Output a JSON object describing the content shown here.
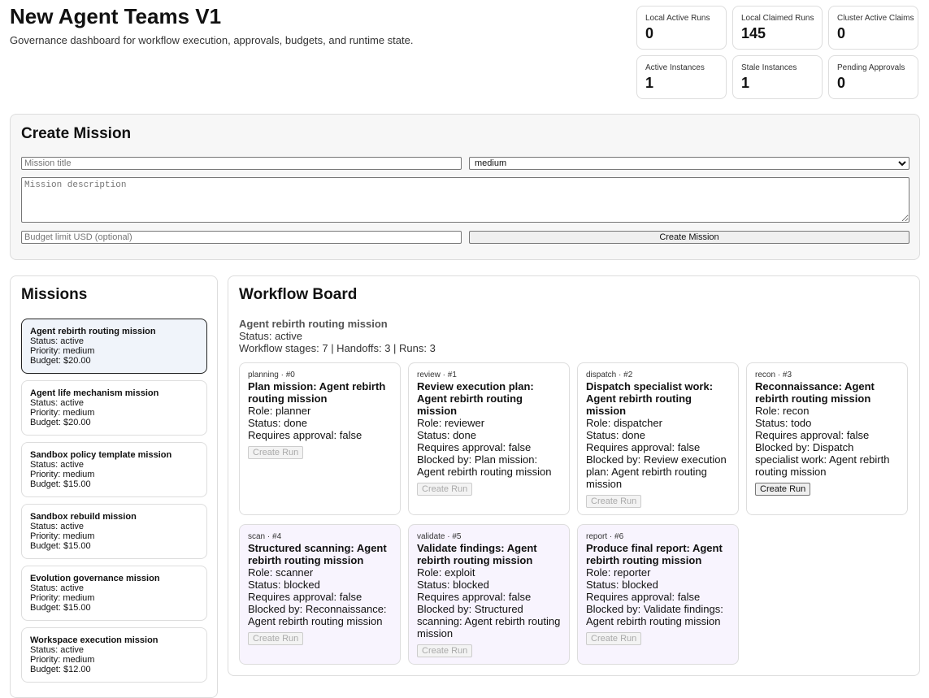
{
  "app": {
    "title": "New Agent Teams V1",
    "subtitle": "Governance dashboard for workflow execution, approvals, budgets, and runtime state."
  },
  "stats": [
    {
      "label": "Local Active Runs",
      "value": "0"
    },
    {
      "label": "Local Claimed Runs",
      "value": "145"
    },
    {
      "label": "Cluster Active Claims",
      "value": "0"
    },
    {
      "label": "Active Instances",
      "value": "1"
    },
    {
      "label": "Stale Instances",
      "value": "1"
    },
    {
      "label": "Pending Approvals",
      "value": "0"
    }
  ],
  "create_mission": {
    "heading": "Create Mission",
    "title_placeholder": "Mission title",
    "priority_value": "medium",
    "description_placeholder": "Mission description",
    "budget_placeholder": "Budget limit USD (optional)",
    "submit_label": "Create Mission"
  },
  "missions": {
    "heading": "Missions",
    "items": [
      {
        "name": "Agent rebirth routing mission",
        "status": "Status: active",
        "priority": "Priority: medium",
        "budget": "Budget: $20.00"
      },
      {
        "name": "Agent life mechanism mission",
        "status": "Status: active",
        "priority": "Priority: medium",
        "budget": "Budget: $20.00"
      },
      {
        "name": "Sandbox policy template mission",
        "status": "Status: active",
        "priority": "Priority: medium",
        "budget": "Budget: $15.00"
      },
      {
        "name": "Sandbox rebuild mission",
        "status": "Status: active",
        "priority": "Priority: medium",
        "budget": "Budget: $15.00"
      },
      {
        "name": "Evolution governance mission",
        "status": "Status: active",
        "priority": "Priority: medium",
        "budget": "Budget: $15.00"
      },
      {
        "name": "Workspace execution mission",
        "status": "Status: active",
        "priority": "Priority: medium",
        "budget": "Budget: $12.00"
      }
    ]
  },
  "board": {
    "heading": "Workflow Board",
    "mission_name": "Agent rebirth routing mission",
    "status": "Status: active",
    "counts": "Workflow stages: 7 | Handoffs: 3 | Runs: 3",
    "run_button_label": "Create Run",
    "stages": [
      {
        "meta": "planning · #0",
        "title": "Plan mission: Agent rebirth routing mission",
        "role": "Role: planner",
        "status": "Status: done",
        "approval": "Requires approval: false",
        "blocked_by": ""
      },
      {
        "meta": "review · #1",
        "title": "Review execution plan: Agent rebirth routing mission",
        "role": "Role: reviewer",
        "status": "Status: done",
        "approval": "Requires approval: false",
        "blocked_by": "Blocked by: Plan mission: Agent rebirth routing mission"
      },
      {
        "meta": "dispatch · #2",
        "title": "Dispatch specialist work: Agent rebirth routing mission",
        "role": "Role: dispatcher",
        "status": "Status: done",
        "approval": "Requires approval: false",
        "blocked_by": "Blocked by: Review execution plan: Agent rebirth routing mission"
      },
      {
        "meta": "recon · #3",
        "title": "Reconnaissance: Agent rebirth routing mission",
        "role": "Role: recon",
        "status": "Status: todo",
        "approval": "Requires approval: false",
        "blocked_by": "Blocked by: Dispatch specialist work: Agent rebirth routing mission"
      },
      {
        "meta": "scan · #4",
        "title": "Structured scanning: Agent rebirth routing mission",
        "role": "Role: scanner",
        "status": "Status: blocked",
        "approval": "Requires approval: false",
        "blocked_by": "Blocked by: Reconnaissance: Agent rebirth routing mission"
      },
      {
        "meta": "validate · #5",
        "title": "Validate findings: Agent rebirth routing mission",
        "role": "Role: exploit",
        "status": "Status: blocked",
        "approval": "Requires approval: false",
        "blocked_by": "Blocked by: Structured scanning: Agent rebirth routing mission"
      },
      {
        "meta": "report · #6",
        "title": "Produce final report: Agent rebirth routing mission",
        "role": "Role: reporter",
        "status": "Status: blocked",
        "approval": "Requires approval: false",
        "blocked_by": "Blocked by: Validate findings: Agent rebirth routing mission"
      }
    ]
  }
}
